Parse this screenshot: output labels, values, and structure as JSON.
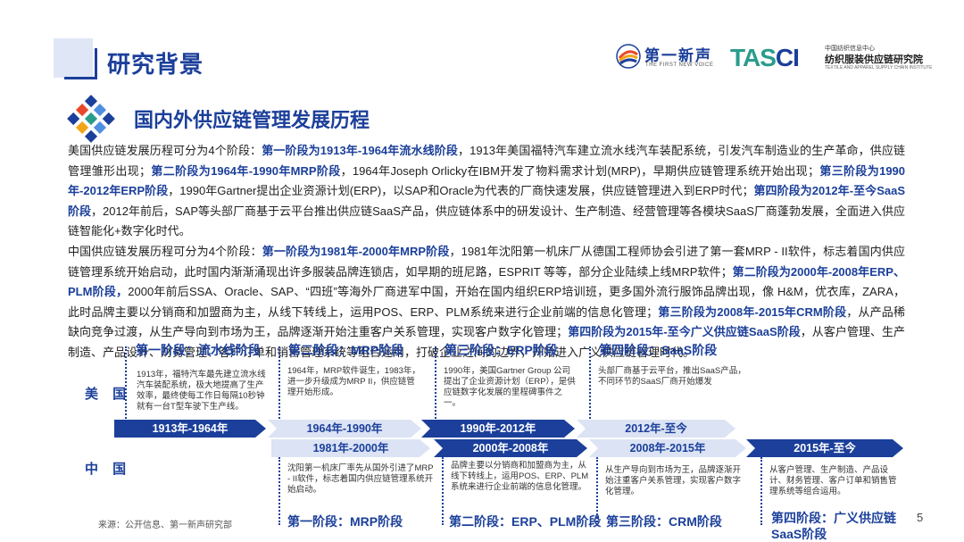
{
  "header": {
    "title": "研究背景",
    "logo_left": {
      "name": "第一新声",
      "sub": "THE FIRST NEW VOICE"
    },
    "logo_right": {
      "word_a": "TAS",
      "word_b": "CI",
      "line1": "中国纺织信息中心",
      "line2": "纺织服装供应链研究院",
      "line3": "TEXTILE AND APPAREL SUPPLY CHAIN INSTITUTE"
    }
  },
  "section": {
    "title": "国内外供应链管理发展历程",
    "icon": "diamond-cluster-icon"
  },
  "paragraph": [
    {
      "t": "美国供应链发展历程可分为4个阶段："
    },
    {
      "t": "第一阶段为1913年-1964年流水线阶段",
      "hl": true
    },
    {
      "t": "，1913年美国福特汽车建立流水线汽车装配系统，引发汽车制造业的生产革命，供应链管理雏形出现；"
    },
    {
      "t": "第二阶段为1964年-1990年MRP阶段",
      "hl": true
    },
    {
      "t": "，1964年Joseph  Orlicky在IBM开发了物料需求计划(MRP)，早期供应链管理系统开始出现；"
    },
    {
      "t": "第三阶段为1990年-2012年ERP阶段",
      "hl": true
    },
    {
      "t": "，1990年Gartner提出企业资源计划(ERP)，以SAP和Oracle为代表的厂商快速发展，供应链管理进入到ERP时代；"
    },
    {
      "t": "第四阶段为2012年-至今SaaS阶段",
      "hl": true
    },
    {
      "t": "，2012年前后，SAP等头部厂商基于云平台推出供应链SaaS产品，供应链体系中的研发设计、生产制造、经营管理等各模块SaaS厂商蓬勃发展，全面进入供应链智能化+数字化时代。",
      "br": true
    },
    {
      "t": "中国供应链发展历程可分为4个阶段："
    },
    {
      "t": "第一阶段为1981年-2000年MRP阶段",
      "hl": true
    },
    {
      "t": "，1981年沈阳第一机床厂从德国工程师协会引进了第一套MRP - II软件，标志着国内供应链管理系统开始启动，此时国内渐渐涌现出许多服装品牌连锁店，如早期的班尼路，ESPRIT 等等，部分企业陆续上线MRP软件；"
    },
    {
      "t": "第二阶段为2000年-2008年ERP、PLM阶段，",
      "hl": true
    },
    {
      "t": "2000年前后SSA、Oracle、SAP、“四班”等海外厂商进军中国，开始在国内组织ERP培训班，更多国外流行服饰品牌出现，像 H&M，优衣库，ZARA，此时品牌主要以分销商和加盟商为主，从线下转线上，运用POS、ERP、PLM系统来进行企业前端的信息化管理；"
    },
    {
      "t": "第三阶段为2008年-2015年CRM阶段",
      "hl": true
    },
    {
      "t": "，从产品稀缺向竞争过渡，从生产导向到市场为王，品牌逐渐开始注重客户关系管理，实现客户数字化管理；"
    },
    {
      "t": "第四阶段为2015年-至今广义供应链SaaS阶段",
      "hl": true
    },
    {
      "t": "，从客户管理、生产制造、产品设计、财务管理、客户订单和销售管理系统等组合运用，打破企业之间的边界，开始进入广义供应链管理时代。"
    }
  ],
  "timeline": {
    "usa": {
      "label": "美 国",
      "phases": [
        {
          "title": "第一阶段：流水线阶段",
          "desc": "1913年，福特汽车最先建立流水线汽车装配系统，极大地提高了生产效率，最终使每工作日每隔10秒钟就有一台T型车驶下生产线。"
        },
        {
          "title": "第二阶段：MRP阶段",
          "desc": "1964年，MRP软件诞生，1983年，进一步升级成为MRP II，供应链管理开始形成。"
        },
        {
          "title": "第三阶段：ERP阶段",
          "desc": "1990年，美国Gartner Group 公司提出了企业资源计划（ERP），是供应链数字化发展的里程碑事件之一。"
        },
        {
          "title": "第四阶段：SaaS阶段",
          "desc": "头部厂商基于云平台，推出SaaS产品，不同环节的SaaS厂商开始爆发"
        }
      ],
      "bands": [
        "1913年-1964年",
        "1964年-1990年",
        "1990年-2012年",
        "2012年-至今"
      ]
    },
    "china": {
      "label": "中 国",
      "bands": [
        "1981年-2000年",
        "2000年-2008年",
        "2008年-2015年",
        "2015年-至今"
      ],
      "phases": [
        {
          "title": "第一阶段：MRP阶段",
          "desc": "沈阳第一机床厂率先从国外引进了MRP - II软件，标志着国内供应链管理系统开始启动。"
        },
        {
          "title": "第二阶段：ERP、PLM阶段",
          "desc": "品牌主要以分销商和加盟商为主，从线下转线上，运用POS、ERP、PLM系统来进行企业前端的信息化管理。"
        },
        {
          "title": "第三阶段：CRM阶段",
          "desc": "从生产导向到市场为王，品牌逐渐开始注重客户关系管理，实现客户数字化管理。"
        },
        {
          "title": "第四阶段：广义供应链SaaS阶段",
          "title_a": "第四阶段：广义供应链",
          "title_b": "SaaS阶段",
          "desc": "从客户管理、生产制造、产品设计、财务管理、客户订单和销售管理系统等组合运用。"
        }
      ]
    }
  },
  "footer": {
    "source": "来源：公开信息、第一新声研究部",
    "page": "5"
  },
  "colors": {
    "primary": "#1b3f9a",
    "band_light": "#dbe3f4",
    "teal": "#2a9c8c"
  }
}
